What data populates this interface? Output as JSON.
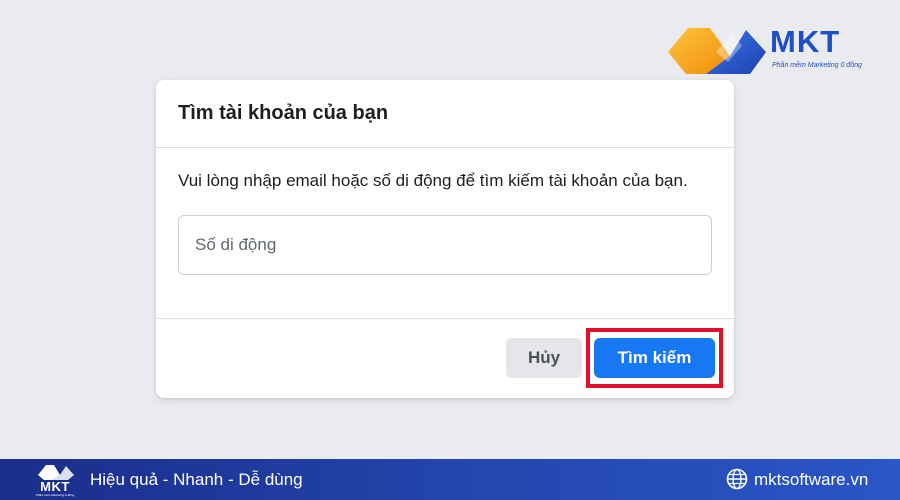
{
  "brand": {
    "logo_text": "MKT",
    "logo_tagline": "Phần mềm Marketing 0 đồng",
    "colors": {
      "primary_blue": "#1f4fc7",
      "logo_orange": "#f7a21b"
    }
  },
  "dialog": {
    "title": "Tìm tài khoản của bạn",
    "description": "Vui lòng nhập email hoặc số di động để tìm kiếm tài khoản của bạn.",
    "input": {
      "placeholder": "Số di động",
      "value": ""
    },
    "buttons": {
      "cancel": "Hủy",
      "search": "Tìm kiếm"
    },
    "colors": {
      "search_button": "#1877f2",
      "cancel_button": "#e4e6eb",
      "highlight": "#e0102a"
    }
  },
  "banner": {
    "logo_text": "MKT",
    "logo_tagline": "Phần mềm Marketing 0 đồng",
    "slogan": "Hiệu quả - Nhanh - Dễ dùng",
    "website": "mktsoftware.vn",
    "icon": "globe-icon"
  }
}
